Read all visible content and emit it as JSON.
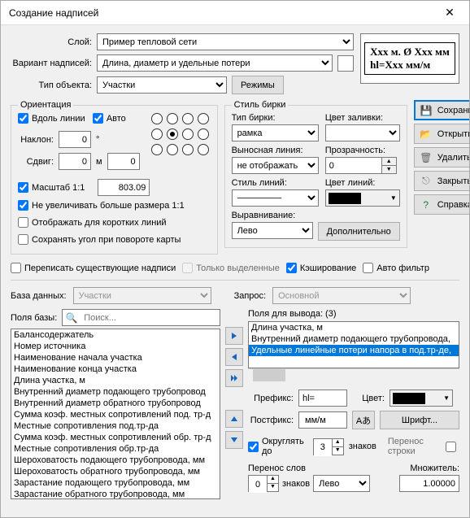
{
  "title": "Создание надписей",
  "top": {
    "layer_label": "Слой:",
    "layer_value": "Пример тепловой сети",
    "variant_label": "Вариант надписей:",
    "variant_value": "Длина, диаметр и удельные потери",
    "type_label": "Тип объекта:",
    "type_value": "Участки",
    "modes_btn": "Режимы",
    "preview_line1": "Xxx м. Ø Xxx мм",
    "preview_line2": "hl=Xxx мм/м"
  },
  "orientation": {
    "legend": "Ориентация",
    "along_line": "Вдоль линии",
    "auto": "Авто",
    "tilt_label": "Наклон:",
    "tilt_value": "0",
    "tilt_unit": "°",
    "shift_label": "Сдвиг:",
    "shift_value": "0",
    "shift_unit": "м",
    "shift2_value": "0",
    "scale_label": "Масштаб 1:1",
    "scale_value": "803.09",
    "no_enlarge": "Не увеличивать больше размера 1:1",
    "show_short": "Отображать для коротких линий",
    "keep_angle": "Сохранять угол при повороте карты"
  },
  "tag_style": {
    "legend": "Стиль бирки",
    "tag_type_label": "Тип бирки:",
    "tag_type_value": "рамка",
    "fill_label": "Цвет заливки:",
    "leader_label": "Выносная линия:",
    "leader_value": "не отображать",
    "opacity_label": "Прозрачность:",
    "opacity_value": "0",
    "line_style_label": "Стиль линий:",
    "line_color_label": "Цвет линий:",
    "align_label": "Выравнивание:",
    "align_value": "Лево",
    "more_btn": "Дополнительно"
  },
  "sidebar": {
    "save": "Сохранить",
    "open": "Открыть",
    "delete": "Удалить",
    "close": "Закрыть",
    "help": "Справка"
  },
  "opts": {
    "overwrite": "Переписать существующие надписи",
    "only_selected": "Только выделенные",
    "caching": "Кэширование",
    "auto_filter": "Авто фильтр"
  },
  "db": {
    "db_label": "База данных:",
    "db_value": "Участки",
    "query_label": "Запрос:",
    "query_value": "Основной",
    "base_fields_label": "Поля базы:",
    "search_placeholder": "Поиск...",
    "out_fields_label": "Поля для вывода: (3)",
    "base_fields": [
      "Балансодержатель",
      "Номер источника",
      "Наименование начала участка",
      "Наименование конца участка",
      "Длина участка, м",
      "Внутренний диаметр подающего трубопровод",
      "Внутренний диаметр обратного трубопровод",
      "Сумма коэф. местных сопротивлений под. тр-д",
      "Местные сопротивления под.тр-да",
      "Сумма коэф. местных сопротивлений обр. тр-д",
      "Местные сопротивления обр.тр-да",
      "Шероховатость подающего трубопровода, мм",
      "Шероховатость обратного трубопровода, мм",
      "Зарастание подающего трубопровода, мм",
      "Зарастание обратного трубопровода, мм"
    ],
    "out_fields": [
      "Длина участка, м",
      "Внутренний диаметр подающего трубопровода,",
      "Удельные линейные потери напора в под.тр-де,"
    ],
    "out_selected_index": 2
  },
  "format": {
    "prefix_label": "Префикс:",
    "prefix_value": "hl=",
    "color_label": "Цвет:",
    "postfix_label": "Постфикс:",
    "postfix_value": " мм/м",
    "font_btn": "Шрифт...",
    "aa_btn": "Aあ",
    "round_label": "Округлять до",
    "round_value": "3",
    "round_unit": "знаков",
    "wrap_line": "Перенос строки",
    "wrap_words_label": "Перенос слов",
    "wrap_words_value": "0",
    "wrap_words_unit": "знаков",
    "wrap_align": "Лево",
    "mult_label": "Множитель:",
    "mult_value": "1.00000"
  }
}
